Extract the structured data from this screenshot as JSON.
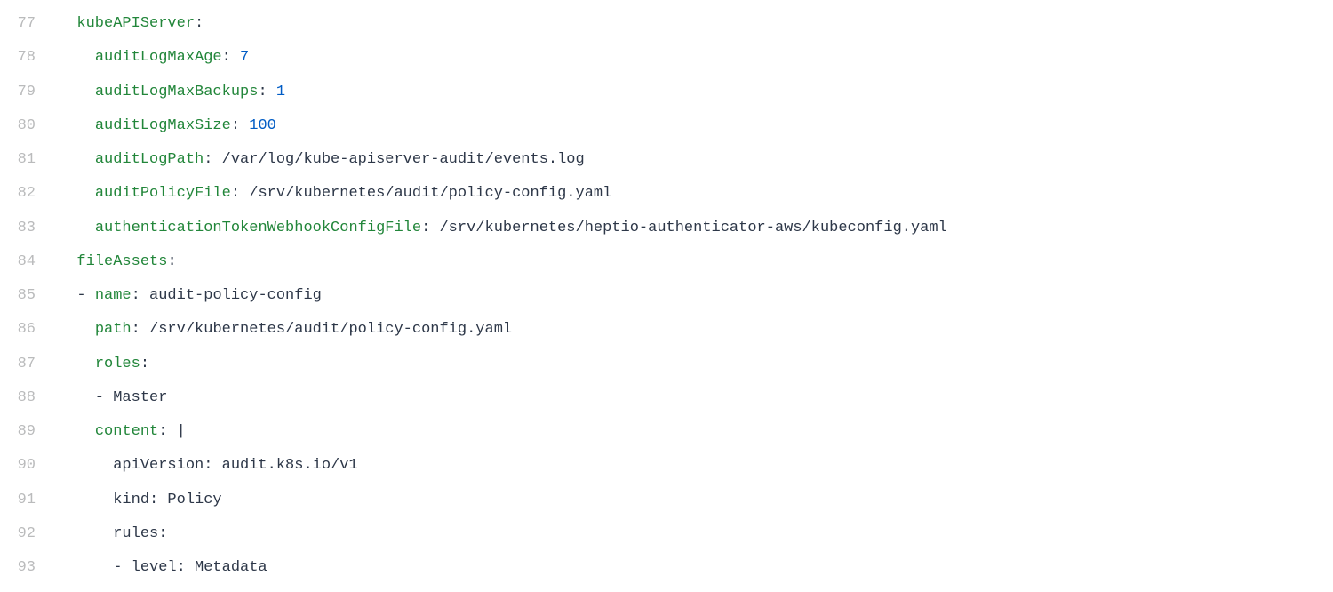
{
  "lines": [
    {
      "no": "77",
      "tokens": [
        {
          "t": "  ",
          "c": "y-plain"
        },
        {
          "t": "kubeAPIServer",
          "c": "y-key"
        },
        {
          "t": ":",
          "c": "y-plain"
        }
      ]
    },
    {
      "no": "78",
      "tokens": [
        {
          "t": "    ",
          "c": "y-plain"
        },
        {
          "t": "auditLogMaxAge",
          "c": "y-key"
        },
        {
          "t": ": ",
          "c": "y-plain"
        },
        {
          "t": "7",
          "c": "y-num"
        }
      ]
    },
    {
      "no": "79",
      "tokens": [
        {
          "t": "    ",
          "c": "y-plain"
        },
        {
          "t": "auditLogMaxBackups",
          "c": "y-key"
        },
        {
          "t": ": ",
          "c": "y-plain"
        },
        {
          "t": "1",
          "c": "y-num"
        }
      ]
    },
    {
      "no": "80",
      "tokens": [
        {
          "t": "    ",
          "c": "y-plain"
        },
        {
          "t": "auditLogMaxSize",
          "c": "y-key"
        },
        {
          "t": ": ",
          "c": "y-plain"
        },
        {
          "t": "100",
          "c": "y-num"
        }
      ]
    },
    {
      "no": "81",
      "tokens": [
        {
          "t": "    ",
          "c": "y-plain"
        },
        {
          "t": "auditLogPath",
          "c": "y-key"
        },
        {
          "t": ": /var/log/kube-apiserver-audit/events.log",
          "c": "y-plain"
        }
      ]
    },
    {
      "no": "82",
      "tokens": [
        {
          "t": "    ",
          "c": "y-plain"
        },
        {
          "t": "auditPolicyFile",
          "c": "y-key"
        },
        {
          "t": ": /srv/kubernetes/audit/policy-config.yaml",
          "c": "y-plain"
        }
      ]
    },
    {
      "no": "83",
      "tokens": [
        {
          "t": "    ",
          "c": "y-plain"
        },
        {
          "t": "authenticationTokenWebhookConfigFile",
          "c": "y-key"
        },
        {
          "t": ": /srv/kubernetes/heptio-authenticator-aws/kubeconfig.yaml",
          "c": "y-plain"
        }
      ]
    },
    {
      "no": "84",
      "tokens": [
        {
          "t": "  ",
          "c": "y-plain"
        },
        {
          "t": "fileAssets",
          "c": "y-key"
        },
        {
          "t": ":",
          "c": "y-plain"
        }
      ]
    },
    {
      "no": "85",
      "tokens": [
        {
          "t": "  - ",
          "c": "y-dash"
        },
        {
          "t": "name",
          "c": "y-key"
        },
        {
          "t": ": audit-policy-config",
          "c": "y-plain"
        }
      ]
    },
    {
      "no": "86",
      "tokens": [
        {
          "t": "    ",
          "c": "y-plain"
        },
        {
          "t": "path",
          "c": "y-key"
        },
        {
          "t": ": /srv/kubernetes/audit/policy-config.yaml",
          "c": "y-plain"
        }
      ]
    },
    {
      "no": "87",
      "tokens": [
        {
          "t": "    ",
          "c": "y-plain"
        },
        {
          "t": "roles",
          "c": "y-key"
        },
        {
          "t": ":",
          "c": "y-plain"
        }
      ]
    },
    {
      "no": "88",
      "tokens": [
        {
          "t": "    - Master",
          "c": "y-plain"
        }
      ]
    },
    {
      "no": "89",
      "tokens": [
        {
          "t": "    ",
          "c": "y-plain"
        },
        {
          "t": "content",
          "c": "y-key"
        },
        {
          "t": ": |",
          "c": "y-plain"
        }
      ]
    },
    {
      "no": "90",
      "tokens": [
        {
          "t": "      apiVersion: audit.k8s.io/v1",
          "c": "y-plain"
        }
      ]
    },
    {
      "no": "91",
      "tokens": [
        {
          "t": "      kind: Policy",
          "c": "y-plain"
        }
      ]
    },
    {
      "no": "92",
      "tokens": [
        {
          "t": "      rules:",
          "c": "y-plain"
        }
      ]
    },
    {
      "no": "93",
      "tokens": [
        {
          "t": "      - level: Metadata",
          "c": "y-plain"
        }
      ]
    }
  ]
}
